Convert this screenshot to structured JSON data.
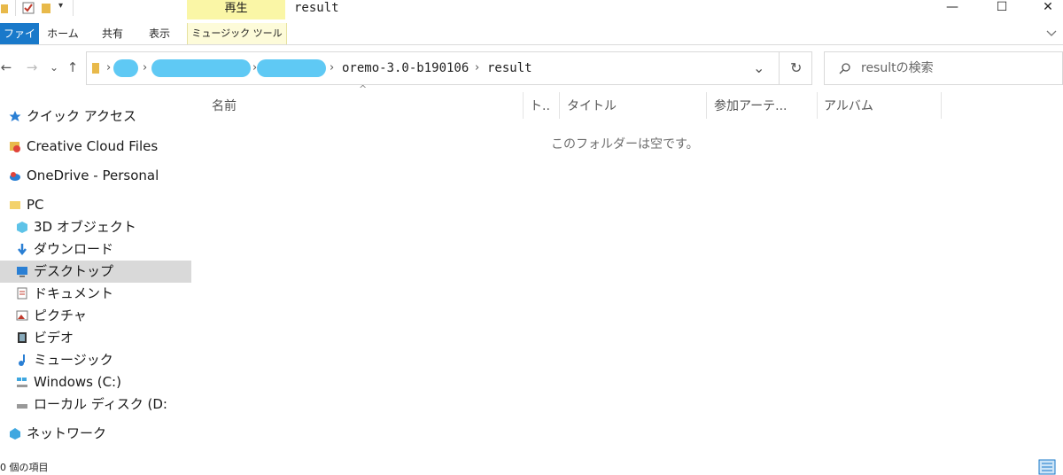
{
  "window": {
    "title": "result",
    "context_tab": "再生",
    "context_sub_tab": "ミュージック ツール",
    "controls": {
      "minimize": "—",
      "maximize": "☐",
      "close": "✕"
    }
  },
  "ribbon": {
    "tabs": [
      "ファイル",
      "ホーム",
      "共有",
      "表示"
    ],
    "expand_icon": "chevron-down-icon"
  },
  "nav": {
    "back": "←",
    "forward": "→",
    "recent": "⌄",
    "up": "↑"
  },
  "address": {
    "crumbs": [
      "oremo-3.0-b190106",
      "result"
    ],
    "separator": "›",
    "dropdown": "⌄",
    "refresh": "↻"
  },
  "search": {
    "placeholder": "resultの検索"
  },
  "sidebar": {
    "items": [
      {
        "label": "クイック アクセス",
        "icon": "star-icon"
      },
      {
        "label": "Creative Cloud Files",
        "icon": "creative-cloud-icon"
      },
      {
        "label": "OneDrive - Personal",
        "icon": "onedrive-cloud-icon"
      },
      {
        "label": "PC",
        "icon": "pc-folder-icon"
      },
      {
        "label": "3D オブジェクト",
        "icon": "cube-icon"
      },
      {
        "label": "ダウンロード",
        "icon": "download-arrow-icon"
      },
      {
        "label": "デスクトップ",
        "icon": "desktop-icon"
      },
      {
        "label": "ドキュメント",
        "icon": "document-icon"
      },
      {
        "label": "ピクチャ",
        "icon": "picture-icon"
      },
      {
        "label": "ビデオ",
        "icon": "film-icon"
      },
      {
        "label": "ミュージック",
        "icon": "music-note-icon"
      },
      {
        "label": "Windows (C:)",
        "icon": "windows-drive-icon"
      },
      {
        "label": "ローカル ディスク (D:",
        "icon": "disk-drive-icon"
      },
      {
        "label": "ネットワーク",
        "icon": "network-icon"
      }
    ]
  },
  "columns": {
    "sort_indicator": "^",
    "headers": [
      "名前",
      "ト..",
      "タイトル",
      "参加アーテ...",
      "アルバム"
    ]
  },
  "content": {
    "empty_message": "このフォルダーは空です。"
  },
  "status": {
    "item_count": "0 個の項目"
  },
  "colors": {
    "accent": "#1979ca",
    "context_tab": "#faf6a6",
    "selected": "#d9d9d9",
    "redacted": "#5fc9f4"
  }
}
